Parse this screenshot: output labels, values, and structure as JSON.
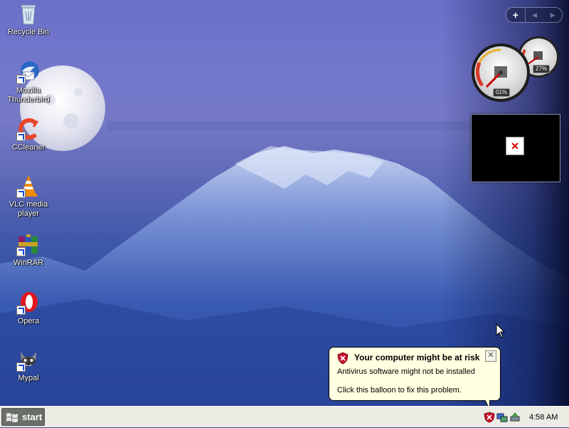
{
  "desktop": {
    "icons": [
      {
        "label": "Recycle Bin"
      },
      {
        "label": "Mozilla Thunderbird"
      },
      {
        "label": "CCleaner"
      },
      {
        "label": "VLC media player"
      },
      {
        "label": "WinRAR"
      },
      {
        "label": "Opera"
      },
      {
        "label": "Mypal"
      }
    ]
  },
  "sidebar": {
    "add_button": "+",
    "prev_button": "◀",
    "next_button": "▶"
  },
  "gadgets": {
    "cpu_percent": "01%",
    "memory_percent": "27%",
    "slideshow_broken_glyph": "✕"
  },
  "balloon": {
    "title": "Your computer might be at risk",
    "line1": "Antivirus software might not be installed",
    "line2": "Click this balloon to fix this problem.",
    "close_glyph": "✕"
  },
  "taskbar": {
    "start_label": "start",
    "clock": "4:58 AM"
  },
  "colors": {
    "balloon_bg": "#ffffe1",
    "taskbar_bg": "#ecebe4",
    "start_button_bg": "#6b6f6a",
    "shield_red": "#c8102e"
  }
}
